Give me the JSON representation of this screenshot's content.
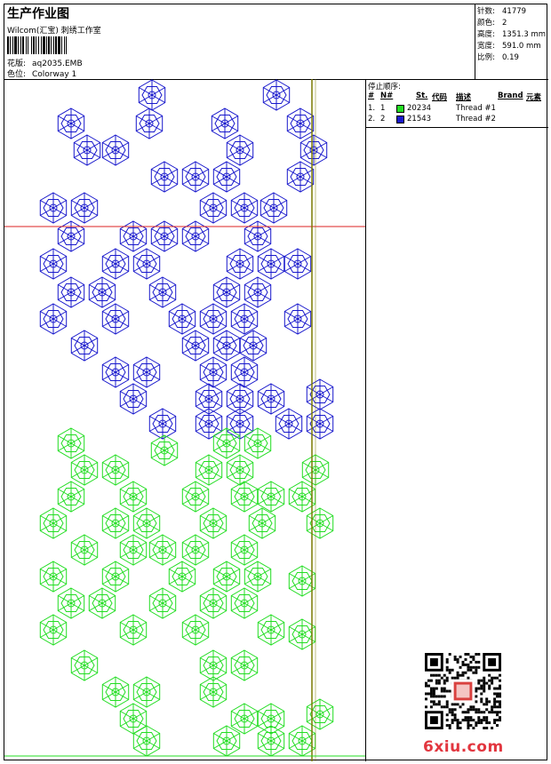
{
  "header": {
    "title": "生产作业图",
    "studio": "Wilcom(汇宝) 刺绣工作室",
    "design_label": "花版:",
    "design_value": "aq2035.EMB",
    "colorway_label": "色位:",
    "colorway_value": "Colorway 1"
  },
  "stats": [
    {
      "label": "针数:",
      "value": "41779"
    },
    {
      "label": "颜色:",
      "value": "2"
    },
    {
      "label": "高度:",
      "value": "1351.3 mm"
    },
    {
      "label": "宽度:",
      "value": "591.0 mm"
    },
    {
      "label": "比例:",
      "value": "0.19"
    }
  ],
  "stop_sequence": {
    "title": "停止顺序:",
    "columns": {
      "num": "#",
      "n": "N#",
      "st": "St.",
      "code": "代码",
      "desc": "描述",
      "brand": "Brand",
      "element": "元素"
    },
    "rows": [
      {
        "num": "1.",
        "n": "1",
        "color": "#22dd22",
        "code": "20234",
        "desc": "Thread #1"
      },
      {
        "num": "2.",
        "n": "2",
        "color": "#1818cc",
        "code": "21543",
        "desc": "Thread #2"
      }
    ]
  },
  "colors": {
    "blue": "#1818cc",
    "green": "#22dd22",
    "guide_red": "#dd2222",
    "guide_olive": "#7a7a00"
  },
  "icons": {
    "barcode": "barcode-icon",
    "qr": "qr-code-icon",
    "motif": "hexagon-star-motif-icon"
  },
  "watermark": "6xiu.com"
}
